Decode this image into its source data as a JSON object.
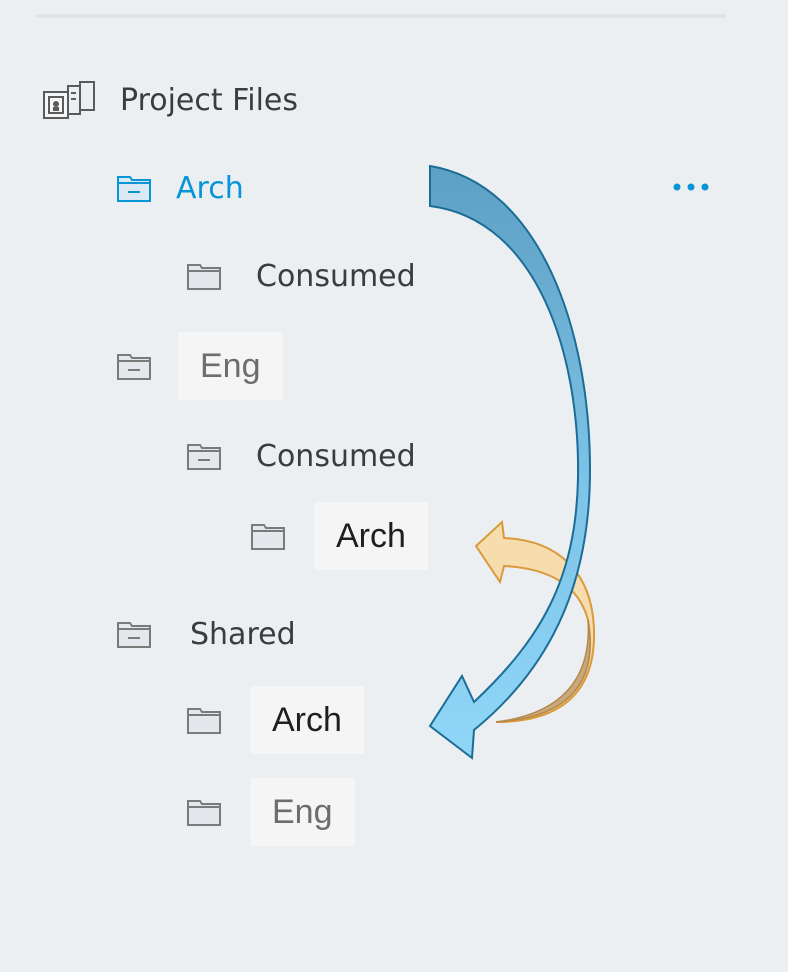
{
  "tree": {
    "root": {
      "label": "Project Files",
      "icon": "project-files-icon"
    },
    "arch": {
      "label": "Arch",
      "icon": "folder-open-icon"
    },
    "arch_consumed": {
      "label": "Consumed",
      "icon": "folder-icon"
    },
    "eng": {
      "label": "Eng",
      "icon": "folder-open-icon"
    },
    "eng_consumed": {
      "label": "Consumed",
      "icon": "folder-open-icon"
    },
    "eng_consumed_arch": {
      "label": "Arch",
      "icon": "folder-icon"
    },
    "shared": {
      "label": "Shared",
      "icon": "folder-open-icon"
    },
    "shared_arch": {
      "label": "Arch",
      "icon": "folder-icon"
    },
    "shared_eng": {
      "label": "Eng",
      "icon": "folder-icon"
    }
  },
  "more_button": {
    "icon": "more-horizontal-icon"
  },
  "colors": {
    "accent": "#0696d7",
    "text": "#3c3c3c",
    "background": "#eceff2",
    "blue_arrow": "#7ab8d6",
    "orange_arrow": "#f5d6a0"
  }
}
